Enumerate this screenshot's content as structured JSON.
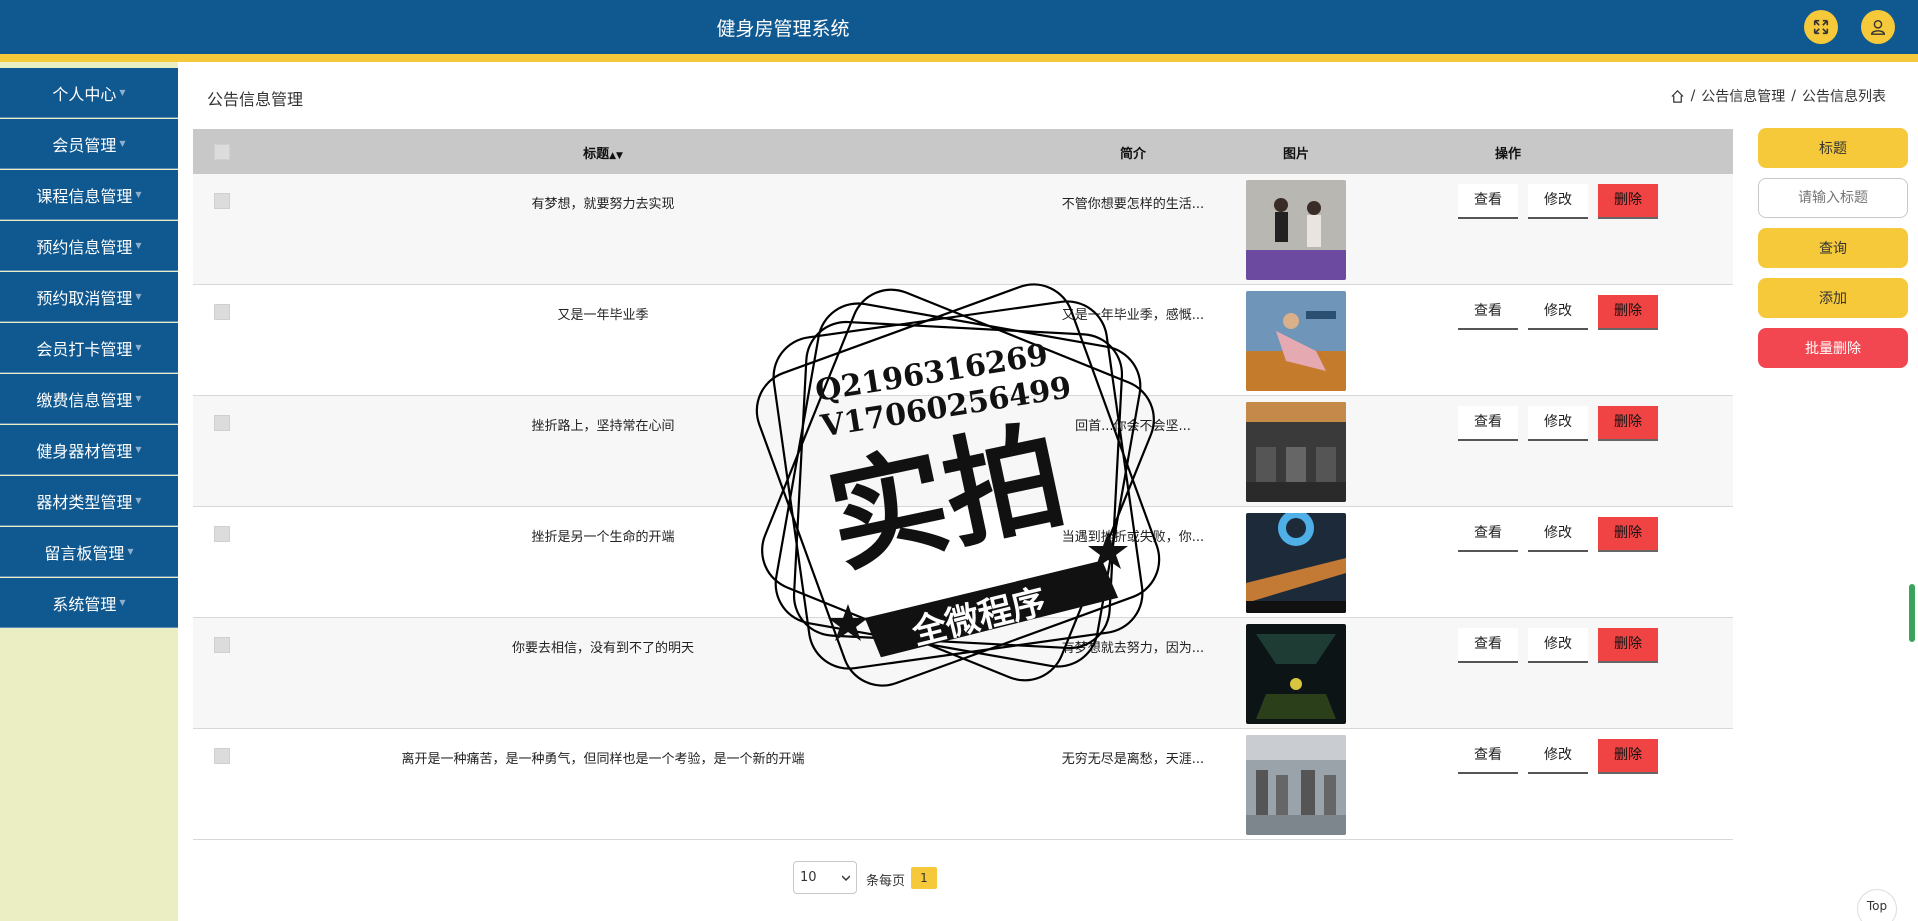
{
  "header": {
    "title": "健身房管理系统",
    "fullscreen_icon": "fullscreen-icon",
    "user_icon": "user-icon",
    "colors": {
      "bar": "#0f5890",
      "accent": "#f6c93b"
    }
  },
  "sidebar": {
    "items": [
      {
        "label": "个人中心"
      },
      {
        "label": "会员管理"
      },
      {
        "label": "课程信息管理"
      },
      {
        "label": "预约信息管理"
      },
      {
        "label": "预约取消管理"
      },
      {
        "label": "会员打卡管理"
      },
      {
        "label": "缴费信息管理"
      },
      {
        "label": "健身器材管理"
      },
      {
        "label": "器材类型管理"
      },
      {
        "label": "留言板管理"
      },
      {
        "label": "系统管理"
      }
    ]
  },
  "page": {
    "title": "公告信息管理",
    "breadcrumb": [
      "公告信息管理",
      "公告信息列表"
    ],
    "breadcrumb_sep": "/"
  },
  "table": {
    "columns": {
      "title": "标题",
      "summary": "简介",
      "image": "图片",
      "actions": "操作"
    },
    "rows": [
      {
        "title": "有梦想，就要努力去实现",
        "summary": "不管你想要怎样的生活...",
        "image": "yoga-image"
      },
      {
        "title": "又是一年毕业季",
        "summary": "又是一年毕业季，感慨...",
        "image": "stretching-image"
      },
      {
        "title": "挫折路上，坚持常在心间",
        "summary": "回首...你会不会坚...",
        "image": "gym-room-image"
      },
      {
        "title": "挫折是另一个生命的开端",
        "summary": "当遇到挫折或失败，你...",
        "image": "treadmill-row-image"
      },
      {
        "title": "你要去相信，没有到不了的明天",
        "summary": "有梦想就去努力，因为...",
        "image": "spin-class-image"
      },
      {
        "title": "离开是一种痛苦，是一种勇气，但同样也是一个考验，是一个新的开端",
        "summary": "无穷无尽是离愁，天涯...",
        "image": "gym-floor-image"
      }
    ],
    "actions": {
      "view": "查看",
      "edit": "修改",
      "delete": "删除"
    }
  },
  "right_panel": {
    "title_button": "标题",
    "search_placeholder": "请输入标题",
    "query": "查询",
    "add": "添加",
    "batch_delete": "批量删除"
  },
  "pagination": {
    "page_size": "10",
    "per_page_label": "条每页",
    "current_page": "1"
  },
  "watermark": {
    "line1": "Q2196316269",
    "line2": "V17060256499",
    "main": "实拍",
    "ribbon": "全微程序"
  },
  "top_button": "Top"
}
